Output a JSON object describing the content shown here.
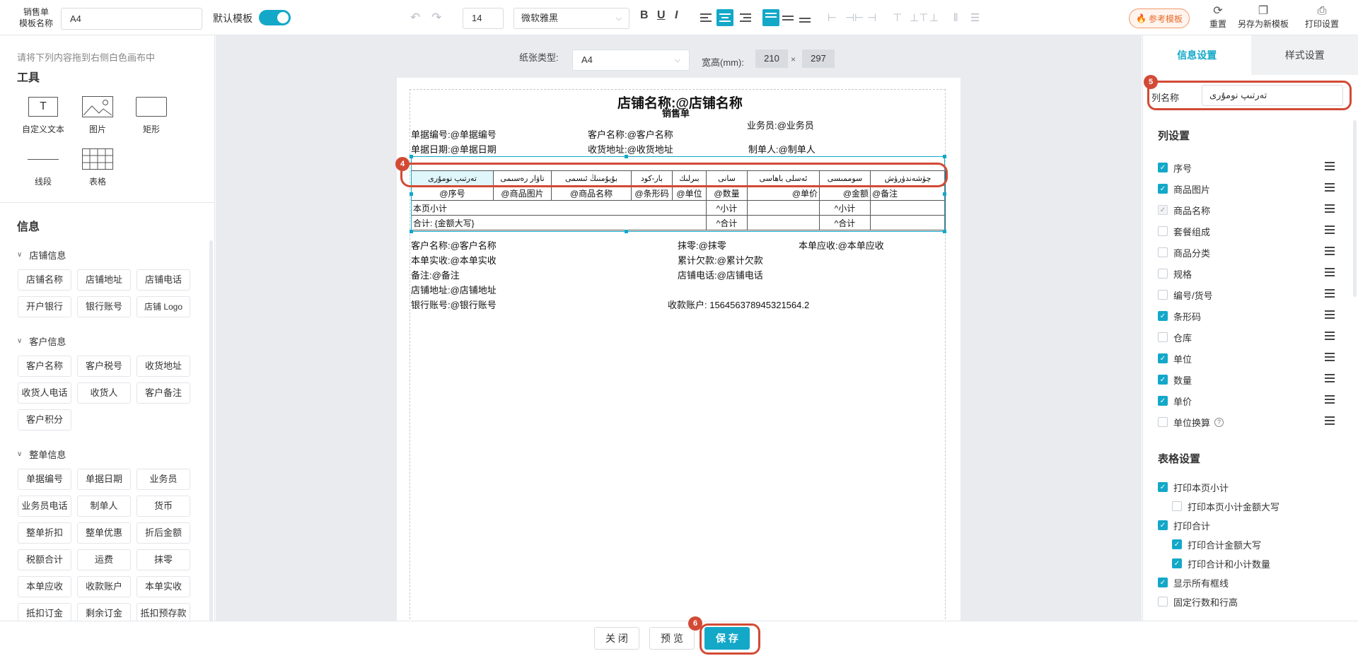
{
  "toolbar": {
    "template_name_label": "销售单\n模板名称",
    "template_name_value": "A4",
    "default_template_label": "默认模板",
    "font_size": "14",
    "font_family": "微软雅黑",
    "bold": "B",
    "underline": "U",
    "italic": "I",
    "reference_template": "参考模板",
    "reset": "重置",
    "save_as_new": "另存为新模板",
    "print_settings": "打印设置"
  },
  "left": {
    "hint": "请将下列内容拖到右侧白色画布中",
    "tools_title": "工具",
    "tools": [
      "自定义文本",
      "图片",
      "矩形",
      "线段",
      "表格"
    ],
    "info_title": "信息",
    "groups": [
      {
        "name": "店铺信息",
        "items": [
          "店铺名称",
          "店铺地址",
          "店铺电话",
          "开户银行",
          "银行账号",
          "店铺 Logo"
        ]
      },
      {
        "name": "客户信息",
        "items": [
          "客户名称",
          "客户税号",
          "收货地址",
          "收货人电话",
          "收货人",
          "客户备注",
          "客户积分"
        ]
      },
      {
        "name": "整单信息",
        "items": [
          "单据编号",
          "单据日期",
          "业务员",
          "业务员电话",
          "制单人",
          "货币",
          "整单折扣",
          "整单优惠",
          "折后金额",
          "税额合计",
          "运费",
          "抹零",
          "本单应收",
          "收款账户",
          "本单实收",
          "抵扣订金",
          "剩余订金",
          "抵扣预存款"
        ]
      }
    ]
  },
  "canvas": {
    "paper_type_label": "纸张类型:",
    "paper_type_value": "A4",
    "size_label": "宽高(mm):",
    "width": "210",
    "height": "297",
    "x": "×"
  },
  "document": {
    "title": "店铺名称:@店铺名称",
    "subtitle": "销售单",
    "salesman": "业务员:@业务员",
    "doc_no": "单据编号:@单据编号",
    "customer": "客户名称:@客户名称",
    "doc_date": "单据日期:@单据日期",
    "ship_addr": "收货地址:@收货地址",
    "maker": "制单人:@制单人",
    "table_head": [
      "تەرتىپ نومۇرى",
      "تاۋار رەسىمى",
      "بۇيۇمنىڭ ئىسمى",
      "بار-كود",
      "بىرلىك",
      "سانى",
      "ئەسلى باھاسى",
      "سوممىسى",
      "چۈشەندۈرۈش"
    ],
    "table_row": [
      "@序号",
      "@商品图片",
      "@商品名称",
      "@条形码",
      "@单位",
      "@数量",
      "@单价",
      "@金额",
      "@备注"
    ],
    "subtotal_label": "本页小计",
    "subtotal_qty": "^小计",
    "subtotal_amt": "^小计",
    "total_label": "合计: {金额大写}",
    "total_qty": "^合计",
    "total_amt": "^合计",
    "f_customer": "客户名称:@客户名称",
    "f_rounding": "抹零:@抹零",
    "f_receivable": "本单应收:@本单应收",
    "f_received": "本单实收:@本单实收",
    "f_debt": "累计欠款:@累计欠款",
    "f_remark": "备注:@备注",
    "f_shop_phone": "店铺电话:@店铺电话",
    "f_shop_addr": "店铺地址:@店铺地址",
    "f_bank": "银行账号:@银行账号",
    "f_account": "收款账户:  156456378945321564.2"
  },
  "right": {
    "tab_info": "信息设置",
    "tab_style": "样式设置",
    "colname_label": "列名称",
    "colname_value": "تەرتىپ نومۇرى",
    "col_settings_title": "列设置",
    "columns": [
      {
        "label": "序号",
        "state": "on"
      },
      {
        "label": "商品图片",
        "state": "on"
      },
      {
        "label": "商品名称",
        "state": "dis"
      },
      {
        "label": "套餐组成",
        "state": "off"
      },
      {
        "label": "商品分类",
        "state": "off"
      },
      {
        "label": "规格",
        "state": "off"
      },
      {
        "label": "编号/货号",
        "state": "off"
      },
      {
        "label": "条形码",
        "state": "on"
      },
      {
        "label": "仓库",
        "state": "off"
      },
      {
        "label": "单位",
        "state": "on"
      },
      {
        "label": "数量",
        "state": "on"
      },
      {
        "label": "单价",
        "state": "on"
      },
      {
        "label": "单位换算",
        "state": "off"
      }
    ],
    "table_settings_title": "表格设置",
    "table_settings": [
      {
        "label": "打印本页小计",
        "state": "on",
        "indent": false
      },
      {
        "label": "打印本页小计金额大写",
        "state": "off",
        "indent": true
      },
      {
        "label": "打印合计",
        "state": "on",
        "indent": false
      },
      {
        "label": "打印合计金额大写",
        "state": "on",
        "indent": true
      },
      {
        "label": "打印合计和小计数量",
        "state": "on",
        "indent": true
      },
      {
        "label": "显示所有框线",
        "state": "on",
        "indent": false
      },
      {
        "label": "固定行数和行高",
        "state": "off",
        "indent": false
      }
    ]
  },
  "bottom": {
    "close": "关 闭",
    "preview": "预 览",
    "save": "保 存"
  },
  "steps": {
    "s4": "4",
    "s5": "5",
    "s6": "6"
  },
  "colors": {
    "accent": "#13a8c8",
    "highlight": "#d24a35",
    "reference": "#e96a2a"
  }
}
